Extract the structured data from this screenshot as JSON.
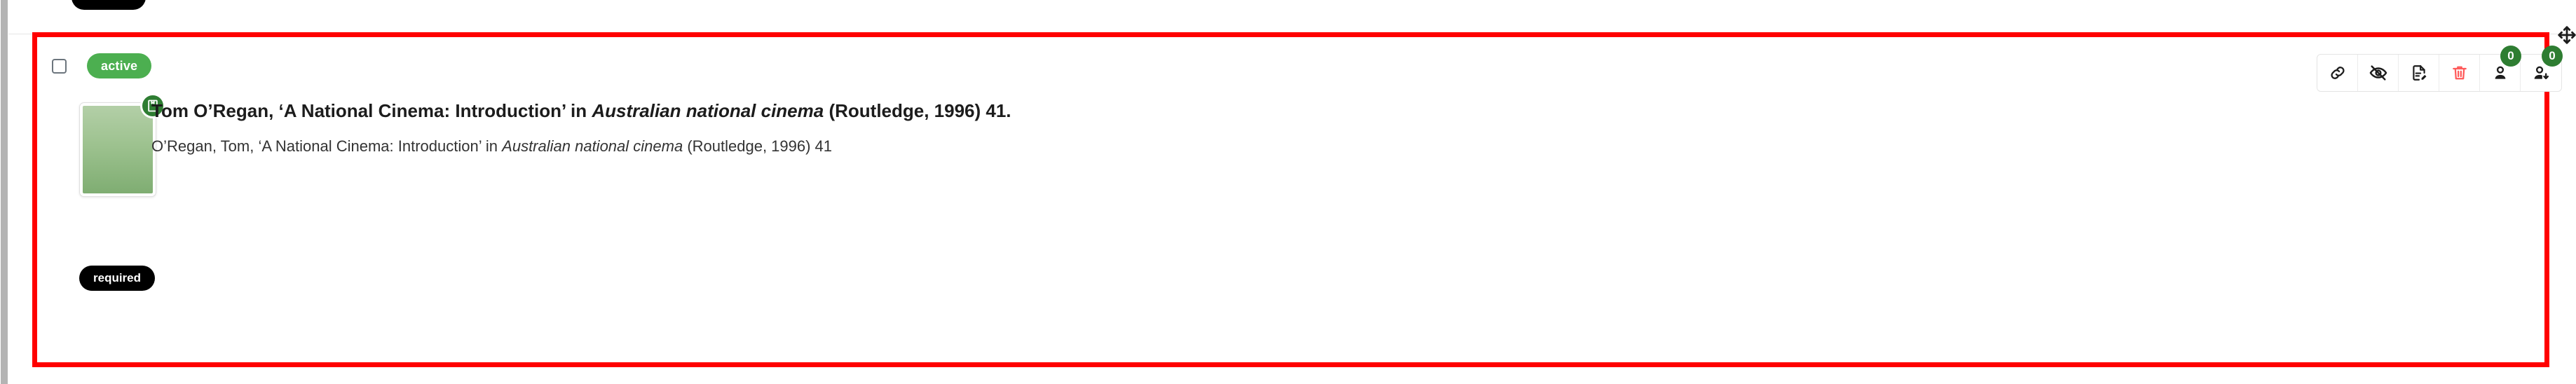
{
  "row": {
    "checkbox_checked": false,
    "status_badge": {
      "label": "active",
      "color": "#4caf50"
    },
    "required_badge": {
      "label": "required",
      "color": "#000000"
    },
    "thumbnail": {
      "alt": "book-cover-placeholder",
      "type_icon": "book-icon",
      "type_icon_color": "#2e7d32",
      "gradient_top": "#b3cfa7",
      "gradient_bottom": "#7fad72"
    },
    "citation": {
      "title_parts": [
        {
          "text": "Tom O’Regan, ‘A National Cinema: Introduction’ in ",
          "italic": false
        },
        {
          "text": "Australian national cinema",
          "italic": true
        },
        {
          "text": " (Routledge, 1996) 41.",
          "italic": false
        }
      ],
      "title_plain": "Tom O’Regan, ‘A National Cinema: Introduction’ in Australian national cinema (Routledge, 1996) 41.",
      "subtitle_parts": [
        {
          "text": "O’Regan, Tom, ‘A National Cinema: Introduction’ in ",
          "italic": false
        },
        {
          "text": "Australian national cinema",
          "italic": true
        },
        {
          "text": " (Routledge, 1996) 41",
          "italic": false
        }
      ],
      "subtitle_plain": "O’Regan, Tom, ‘A National Cinema: Introduction’ in Australian national cinema (Routledge, 1996) 41"
    }
  },
  "toolbar": {
    "buttons": [
      {
        "name": "link-icon",
        "title": "Link",
        "color": "#1c1c1c",
        "badge": null
      },
      {
        "name": "eye-off-icon",
        "title": "Hide",
        "color": "#1c1c1c",
        "badge": null
      },
      {
        "name": "file-edit-icon",
        "title": "Edit note",
        "color": "#1c1c1c",
        "badge": null
      },
      {
        "name": "trash-icon",
        "title": "Delete",
        "color": "#ff5a5a",
        "badge": null
      },
      {
        "name": "user-icon",
        "title": "Readings",
        "color": "#1c1c1c",
        "badge": "0"
      },
      {
        "name": "user-download-icon",
        "title": "Downloads",
        "color": "#1c1c1c",
        "badge": "0"
      }
    ],
    "badge_color": "#2e7d32"
  },
  "drag_handle": {
    "name": "move-icon",
    "title": "Drag to reorder"
  },
  "highlight": {
    "color": "#ff0000",
    "border_width_px": 7
  }
}
